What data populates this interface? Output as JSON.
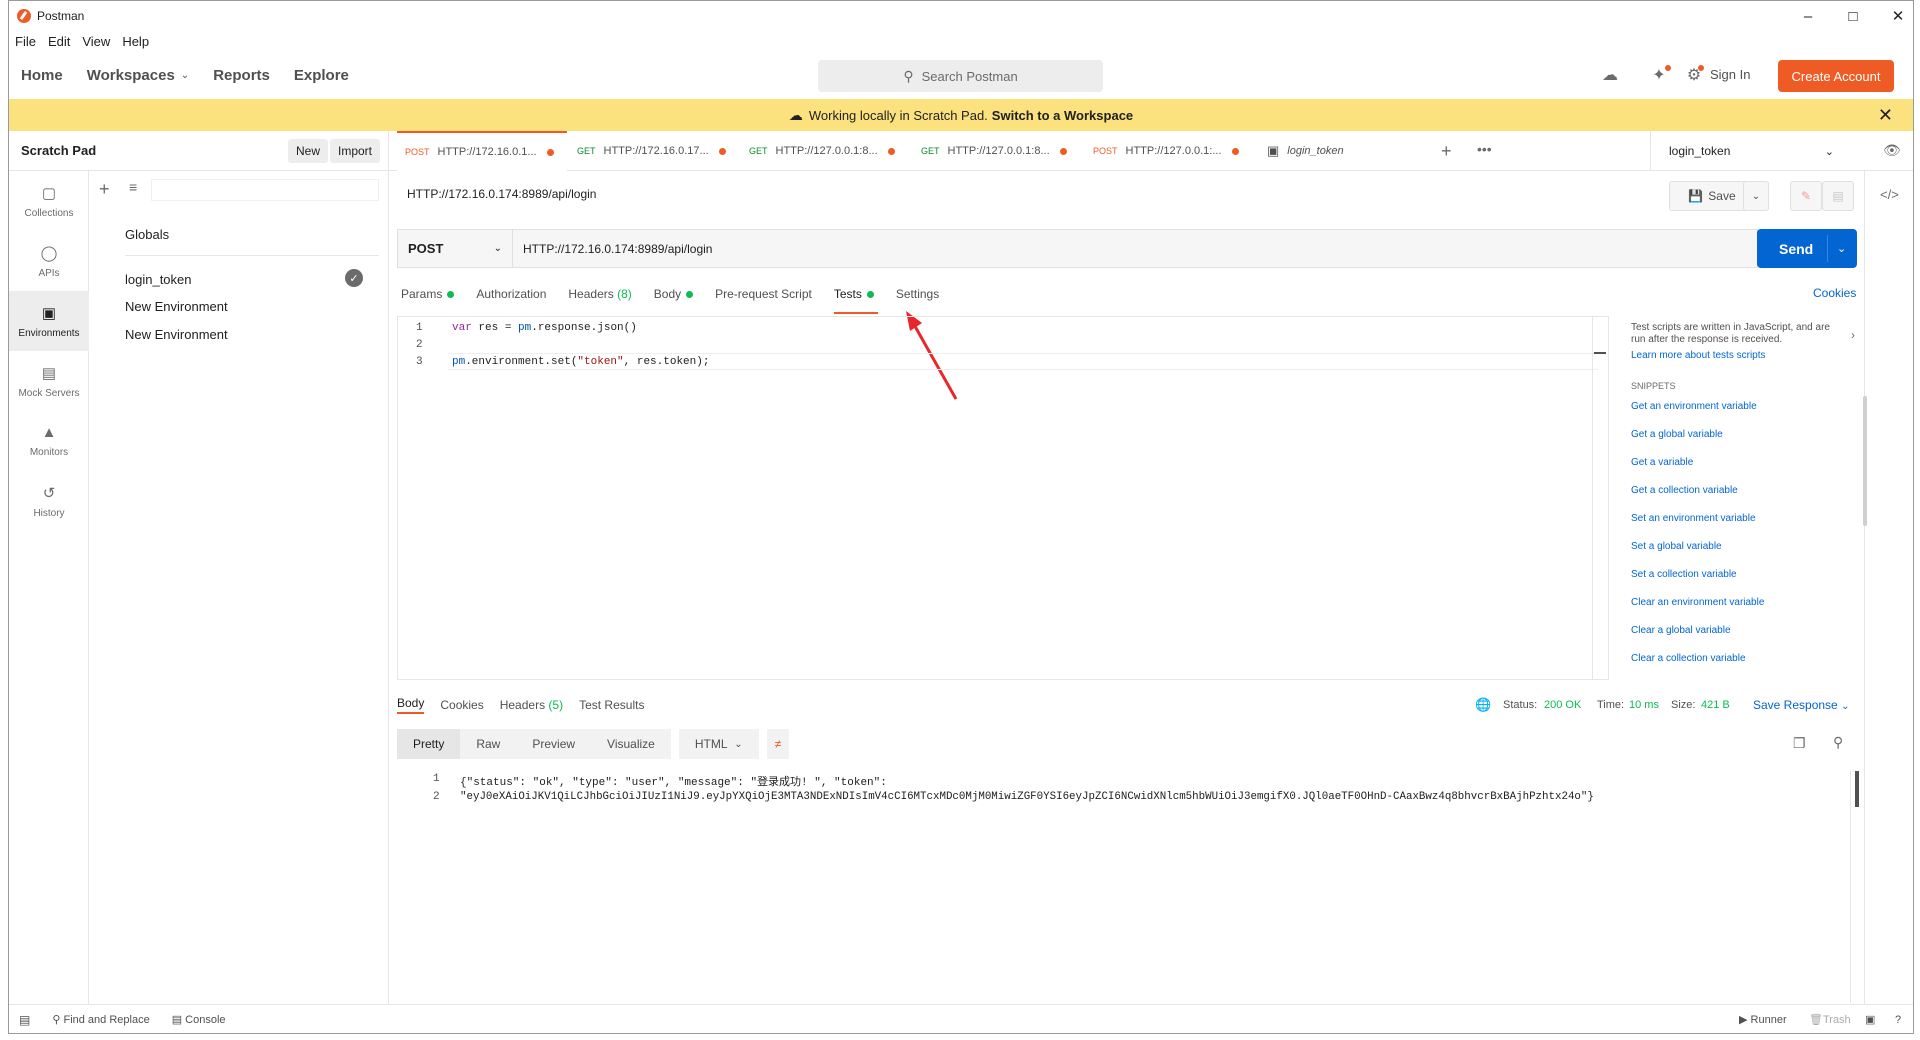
{
  "app": {
    "title": "Postman"
  },
  "menu": [
    "File",
    "Edit",
    "View",
    "Help"
  ],
  "header": {
    "nav": [
      "Home",
      "Workspaces",
      "Reports",
      "Explore"
    ],
    "search_placeholder": "Search Postman",
    "sign_in": "Sign In",
    "create_account": "Create Account"
  },
  "banner": {
    "text": "Working locally in Scratch Pad.",
    "link": "Switch to a Workspace"
  },
  "sidebar": {
    "title": "Scratch Pad",
    "new_label": "New",
    "import_label": "Import",
    "rail": [
      "Collections",
      "APIs",
      "Environments",
      "Mock Servers",
      "Monitors",
      "History"
    ],
    "globals": "Globals",
    "environments": [
      "login_token",
      "New Environment",
      "New Environment"
    ]
  },
  "tabs": [
    {
      "method": "POST",
      "label": "HTTP://172.16.0.1...",
      "dot": true
    },
    {
      "method": "GET",
      "label": "HTTP://172.16.0.17...",
      "dot": true
    },
    {
      "method": "GET",
      "label": "HTTP://127.0.0.1:8...",
      "dot": true
    },
    {
      "method": "GET",
      "label": "HTTP://127.0.0.1:8...",
      "dot": true
    },
    {
      "method": "POST",
      "label": "HTTP://127.0.0.1:...",
      "dot": true
    },
    {
      "method": "",
      "label": "login_token",
      "dot": false
    }
  ],
  "env_select": "login_token",
  "request": {
    "title": "HTTP://172.16.0.174:8989/api/login",
    "save": "Save",
    "method": "POST",
    "url": "HTTP://172.16.0.174:8989/api/login",
    "send": "Send",
    "tabs": [
      "Params",
      "Authorization",
      "Headers",
      "(8)",
      "Body",
      "Pre-request Script",
      "Tests",
      "Settings"
    ],
    "cookies": "Cookies"
  },
  "editor": {
    "line_numbers": [
      "1",
      "2",
      "3"
    ],
    "line1": {
      "kw": "var",
      "rest": " res = ",
      "obj": "pm",
      "tail": ".response.json()"
    },
    "line3": {
      "obj": "pm",
      "method": ".environment.set(",
      "str": "\"token\"",
      "tail": ", res.token);"
    }
  },
  "snippets": {
    "intro": "Test scripts are written in JavaScript, and are run after the response is received.",
    "learn_more": "Learn more about tests scripts",
    "heading": "SNIPPETS",
    "items": [
      "Get an environment variable",
      "Get a global variable",
      "Get a variable",
      "Get a collection variable",
      "Set an environment variable",
      "Set a global variable",
      "Set a collection variable",
      "Clear an environment variable",
      "Clear a global variable",
      "Clear a collection variable"
    ]
  },
  "response": {
    "tabs": [
      "Body",
      "Cookies",
      "Headers",
      "(5)",
      "Test Results"
    ],
    "status_label": "Status:",
    "status": "200 OK",
    "time_label": "Time:",
    "time": "10 ms",
    "size_label": "Size:",
    "size": "421 B",
    "save_response": "Save Response",
    "views": [
      "Pretty",
      "Raw",
      "Preview",
      "Visualize"
    ],
    "format": "HTML",
    "line_numbers": [
      "1",
      "2"
    ],
    "line1": "{\"status\": \"ok\", \"type\": \"user\", \"message\": \"登录成功! \", \"token\":",
    "line2": "\"eyJ0eXAiOiJKV1QiLCJhbGciOiJIUzI1NiJ9.eyJpYXQiOjE3MTA3NDExNDIsImV4cCI6MTcxMDc0MjM0MiwiZGF0YSI6eyJpZCI6NCwidXNlcm5hbWUiOiJ3emgifX0.JQl0aeTF0OHnD-CAaxBwz4q8bhvcrBxBAjhPzhtx24o\"}"
  },
  "statusbar": {
    "find_replace": "Find and Replace",
    "console": "Console",
    "runner": "Runner",
    "trash": "Trash"
  }
}
